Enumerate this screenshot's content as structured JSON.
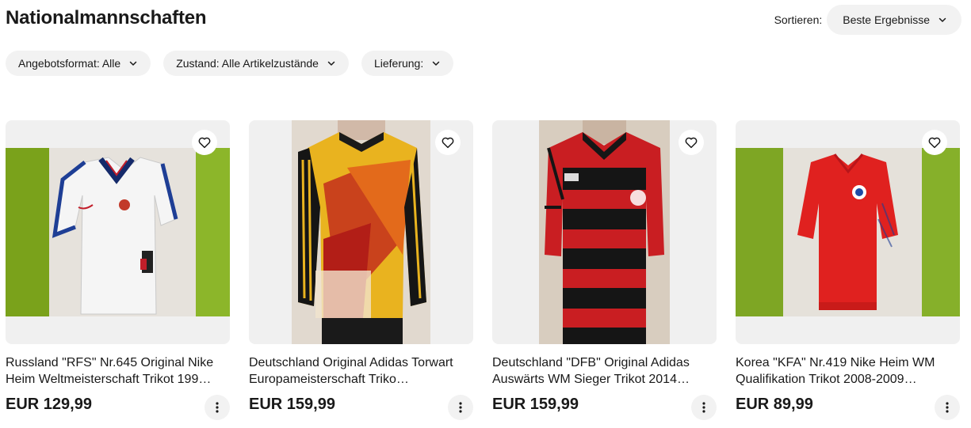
{
  "header": {
    "title": "Nationalmannschaften",
    "sort_label": "Sortieren:",
    "sort_value": "Beste Ergebnisse"
  },
  "filters": [
    {
      "label": "Angebotsformat: Alle"
    },
    {
      "label": "Zustand: Alle Artikelzustände"
    },
    {
      "label": "Lieferung:"
    }
  ],
  "products": [
    {
      "title": "Russland \"RFS\" Nr.645 Original Nike Heim Weltmeisterschaft Trikot 199…",
      "price": "EUR 129,99"
    },
    {
      "title": "Deutschland Original Adidas Torwart Europameisterschaft Triko…",
      "price": "EUR 159,99"
    },
    {
      "title": "Deutschland \"DFB\" Original Adidas Auswärts WM Sieger Trikot 2014…",
      "price": "EUR 159,99"
    },
    {
      "title": "Korea \"KFA\" Nr.419 Nike Heim WM Qualifikation Trikot 2008-2009…",
      "price": "EUR 89,99"
    }
  ],
  "icons": {
    "chevron": "chevron-down-icon",
    "favorite": "heart-icon",
    "more": "more-vertical-icon"
  }
}
